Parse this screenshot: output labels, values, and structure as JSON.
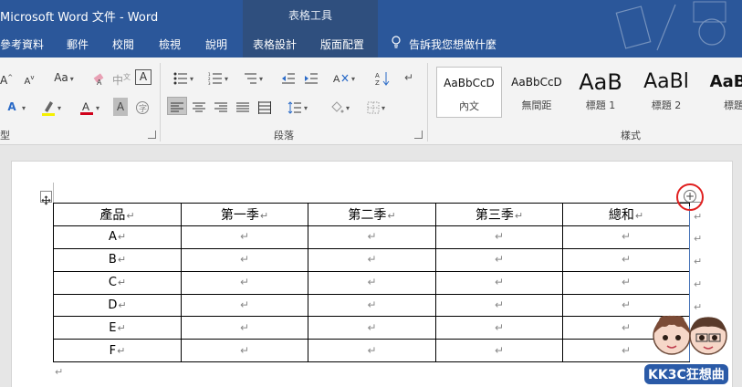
{
  "window": {
    "title": "Microsoft Word 文件  -  Word",
    "context_tools": "表格工具"
  },
  "tabs": [
    "參考資料",
    "郵件",
    "校閱",
    "檢視",
    "說明",
    "表格設計",
    "版面配置"
  ],
  "tell_me": "告訴我您想做什麼",
  "ribbon": {
    "font_group_label": "型",
    "paragraph_group_label": "段落",
    "styles_group_label": "樣式",
    "font_size_label": "Aa",
    "styles": [
      {
        "sample": "AaBbCcD",
        "name": "內文"
      },
      {
        "sample": "AaBbCcD",
        "name": "無間距"
      },
      {
        "sample": "AaB",
        "name": "標題 1"
      },
      {
        "sample": "AaBl",
        "name": "標題 2"
      },
      {
        "sample": "AaBb",
        "name": "標題"
      }
    ]
  },
  "table": {
    "headers": [
      "產品",
      "第一季",
      "第二季",
      "第三季",
      "總和"
    ],
    "rows": [
      [
        "A",
        "",
        "",
        "",
        ""
      ],
      [
        "B",
        "",
        "",
        "",
        ""
      ],
      [
        "C",
        "",
        "",
        "",
        ""
      ],
      [
        "D",
        "",
        "",
        "",
        ""
      ],
      [
        "E",
        "",
        "",
        "",
        ""
      ],
      [
        "F",
        "",
        "",
        "",
        ""
      ]
    ]
  },
  "watermark": "KK3C狂想曲",
  "colors": {
    "titlebar": "#2b579a",
    "context_tab": "#2f4f7e",
    "insert_highlight": "#e02020"
  }
}
